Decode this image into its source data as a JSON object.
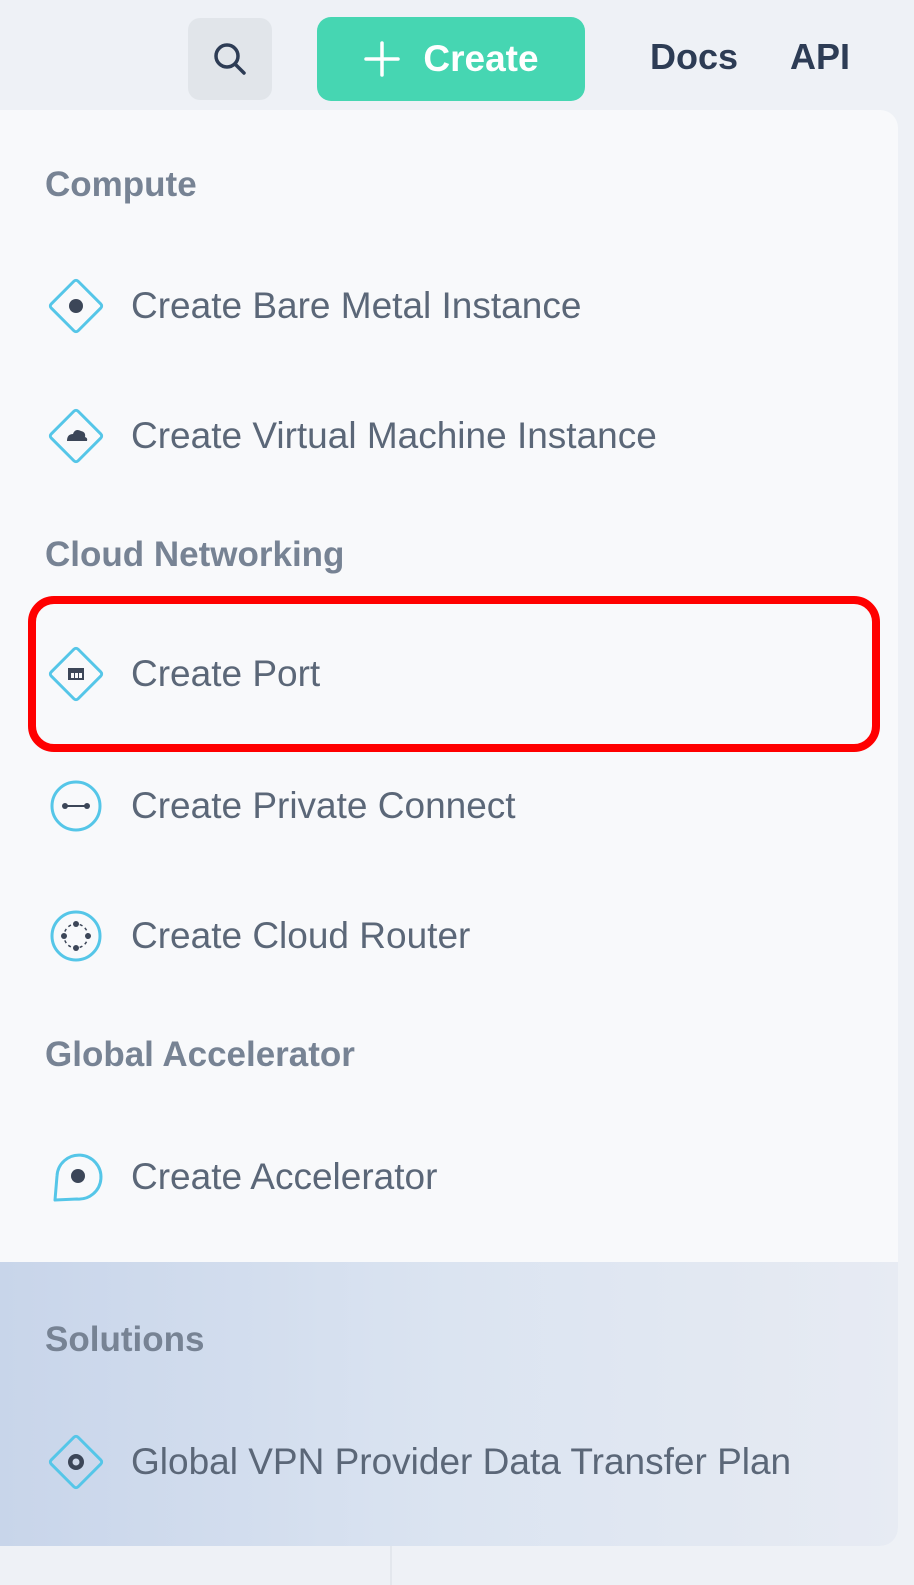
{
  "topbar": {
    "search_icon": "search-icon",
    "create_label": "Create",
    "docs_label": "Docs",
    "api_label": "API"
  },
  "menu": {
    "sections": [
      {
        "title": "Compute",
        "items": [
          {
            "label": "Create Bare Metal Instance",
            "icon": "bare-metal-icon"
          },
          {
            "label": "Create Virtual Machine Instance",
            "icon": "virtual-machine-icon"
          }
        ]
      },
      {
        "title": "Cloud Networking",
        "items": [
          {
            "label": "Create Port",
            "icon": "port-icon",
            "highlighted": true
          },
          {
            "label": "Create Private Connect",
            "icon": "private-connect-icon"
          },
          {
            "label": "Create Cloud Router",
            "icon": "cloud-router-icon"
          }
        ]
      },
      {
        "title": "Global Accelerator",
        "items": [
          {
            "label": "Create Accelerator",
            "icon": "accelerator-icon"
          }
        ]
      },
      {
        "title": "Solutions",
        "items": [
          {
            "label": "Global VPN Provider Data Transfer Plan",
            "icon": "vpn-plan-icon"
          }
        ]
      }
    ]
  },
  "colors": {
    "accent": "#46d6b2",
    "icon": "#55c6e8",
    "highlight": "#ff0000"
  }
}
